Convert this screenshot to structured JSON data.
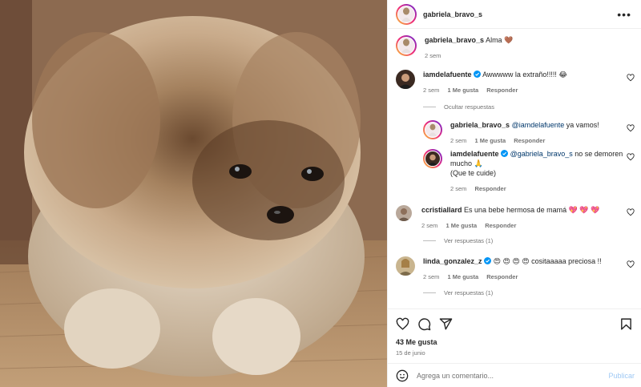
{
  "post": {
    "author": "gabriela_bravo_s",
    "caption": {
      "username": "gabriela_bravo_s",
      "text": "Alma 🤎",
      "age": "2 sem"
    },
    "likes": "43 Me gusta",
    "date": "15 de junio"
  },
  "comments": [
    {
      "username": "iamdelafuente",
      "verified": true,
      "text": "Awwwww la extraño!!!!! 😂",
      "age": "2 sem",
      "likes": "1 Me gusta",
      "reply": "Responder",
      "toggle": "Ocultar respuestas"
    },
    {
      "username": "gabriela_bravo_s",
      "mention": "@iamdelafuente",
      "text": " ya vamos!",
      "age": "2 sem",
      "likes": "1 Me gusta",
      "reply": "Responder"
    },
    {
      "username": "iamdelafuente",
      "verified": true,
      "mention": "@gabriela_bravo_s",
      "text": " no se demoren mucho 🙏",
      "text2": "(Que te cuide)",
      "age": "2 sem",
      "reply": "Responder"
    },
    {
      "username": "ccristiallard",
      "text": "Es una bebe hermosa de mamá 💖 💖 💖",
      "age": "2 sem",
      "likes": "1 Me gusta",
      "reply": "Responder",
      "toggle": "Ver respuestas (1)"
    },
    {
      "username": "linda_gonzalez_z",
      "verified": true,
      "text": "😍 😍 😍 😍 cositaaaaa preciosa !!",
      "age": "2 sem",
      "likes": "1 Me gusta",
      "reply": "Responder",
      "toggle": "Ver respuestas (1)"
    }
  ],
  "composer": {
    "placeholder": "Agrega un comentario...",
    "post": "Publicar"
  },
  "colors": {
    "link": "#00376b",
    "verified": "#0095f6",
    "muted": "#737373",
    "post_button": "#9ec8f4"
  },
  "icons": [
    "more-icon",
    "heart-icon",
    "comment-icon",
    "share-icon",
    "bookmark-icon",
    "emoji-icon",
    "verified-icon"
  ]
}
